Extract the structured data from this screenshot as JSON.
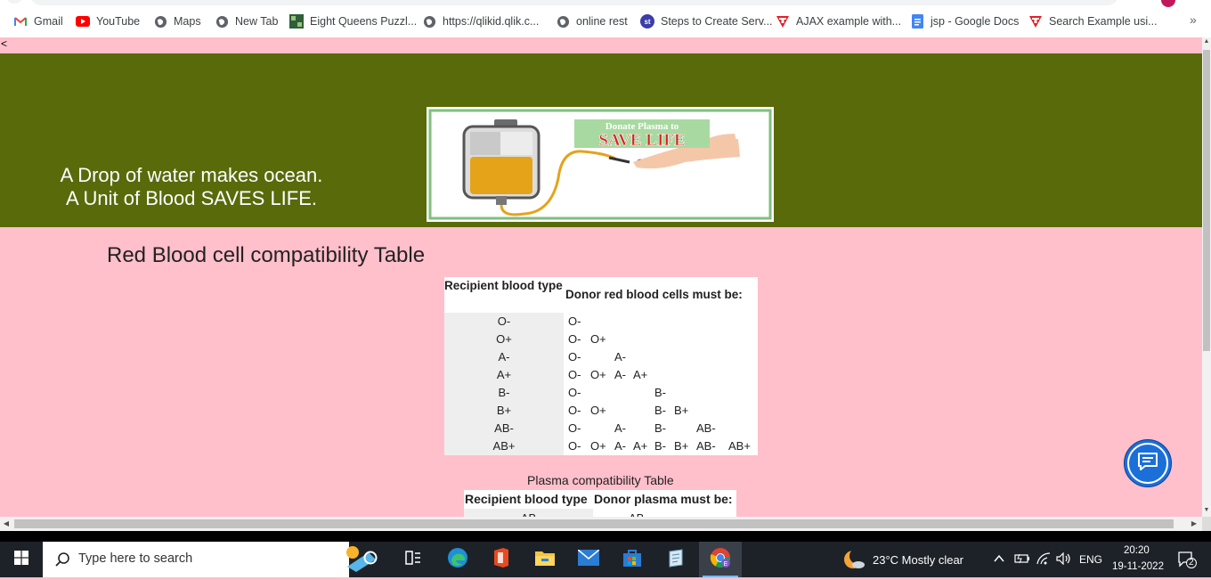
{
  "bookmarks": [
    {
      "label": "Gmail",
      "icon": "gmail-icon"
    },
    {
      "label": "YouTube",
      "icon": "youtube-icon"
    },
    {
      "label": "Maps",
      "icon": "globe-icon"
    },
    {
      "label": "New Tab",
      "icon": "globe-icon"
    },
    {
      "label": "Eight Queens Puzzl...",
      "icon": "puzzle-image-icon"
    },
    {
      "label": "https://qlikid.qlik.c...",
      "icon": "globe-icon"
    },
    {
      "label": "online rest",
      "icon": "globe-icon"
    },
    {
      "label": "Steps to Create Serv...",
      "icon": "st-icon"
    },
    {
      "label": "AJAX example with...",
      "icon": "t-logo-icon"
    },
    {
      "label": "jsp - Google Docs",
      "icon": "google-docs-icon"
    },
    {
      "label": "Search Example usi...",
      "icon": "t-logo-icon"
    }
  ],
  "bookmarks_more": "»",
  "page": {
    "back_link": "<",
    "slogan_line1": "A Drop of water makes ocean.",
    "slogan_line2": "A Unit of Blood SAVES LIFE.",
    "banner_image": {
      "line1": "Donate Plasma to",
      "line2": "SAVE LIFE"
    },
    "rbc_title": "Red Blood cell compatibility Table",
    "rbc_table": {
      "header_recipient": "Recipient blood type",
      "header_donor": "Donor red blood cells must be:",
      "rows": [
        {
          "recipient": "O-",
          "donors": [
            "O-",
            "",
            "",
            "",
            "",
            "",
            "",
            ""
          ]
        },
        {
          "recipient": "O+",
          "donors": [
            "O-",
            "O+",
            "",
            "",
            "",
            "",
            "",
            ""
          ]
        },
        {
          "recipient": "A-",
          "donors": [
            "O-",
            "",
            "A-",
            "",
            "",
            "",
            "",
            ""
          ]
        },
        {
          "recipient": "A+",
          "donors": [
            "O-",
            "O+",
            "A-",
            "A+",
            "",
            "",
            "",
            ""
          ]
        },
        {
          "recipient": "B-",
          "donors": [
            "O-",
            "",
            "",
            "",
            "B-",
            "",
            "",
            ""
          ]
        },
        {
          "recipient": "B+",
          "donors": [
            "O-",
            "O+",
            "",
            "",
            "B-",
            "B+",
            "",
            ""
          ]
        },
        {
          "recipient": "AB-",
          "donors": [
            "O-",
            "",
            "A-",
            "",
            "B-",
            "",
            "AB-",
            ""
          ]
        },
        {
          "recipient": "AB+",
          "donors": [
            "O-",
            "O+",
            "A-",
            "A+",
            "B-",
            "B+",
            "AB-",
            "AB+"
          ]
        }
      ]
    },
    "plasma_title": "Plasma compatibility Table",
    "plasma_table": {
      "header_recipient": "Recipient blood type",
      "header_donor": "Donor plasma must be:",
      "partial_row_recipient": "AB",
      "partial_row_donor": "AB"
    }
  },
  "taskbar": {
    "search_placeholder": "Type here to search",
    "weather": "23°C  Mostly clear",
    "language": "ENG",
    "time": "20:20",
    "date": "19-11-2022",
    "notification_count": "2"
  }
}
